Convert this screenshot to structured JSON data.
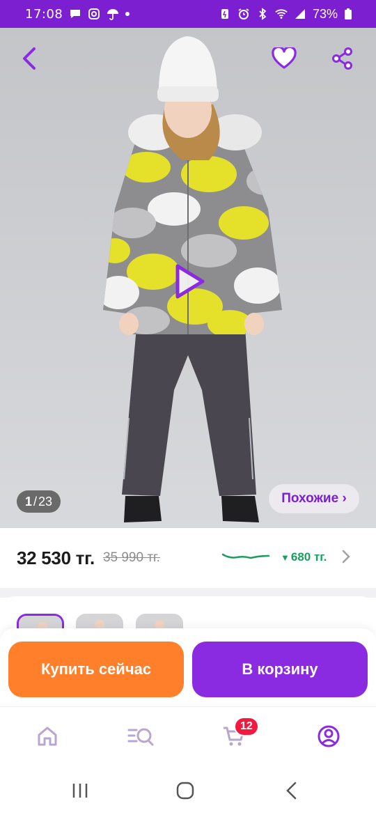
{
  "status_bar": {
    "time": "17:08",
    "battery": "73%",
    "left_icons": [
      "chat-icon",
      "instagram-icon",
      "umbrella-icon",
      "dot-icon"
    ],
    "right_icons": [
      "battery-saver-icon",
      "alarm-icon",
      "bluetooth-icon",
      "wifi-icon",
      "signal-icon",
      "battery-icon"
    ]
  },
  "gallery": {
    "current": "1",
    "separator": "/",
    "total": "23",
    "similar_label": "Похожие ›",
    "icons": [
      "back-arrow-icon",
      "heart-icon",
      "share-icon",
      "play-icon"
    ]
  },
  "price": {
    "current": "32 530 тг.",
    "old": "35 990 тг.",
    "drop": "680 тг.",
    "drop_arrow": "▼",
    "trend_color": "#18a05e"
  },
  "actions": {
    "buy_now": "Купить сейчас",
    "add_to_cart": "В корзину"
  },
  "bottom_nav": {
    "items": [
      "home-icon",
      "catalog-search-icon",
      "cart-icon",
      "profile-icon"
    ],
    "cart_count": "12"
  },
  "colors": {
    "brand": "#8a2be2",
    "status_bar": "#7b1fd1",
    "buy_button": "#ff7f2a",
    "badge": "#f21b3f"
  }
}
